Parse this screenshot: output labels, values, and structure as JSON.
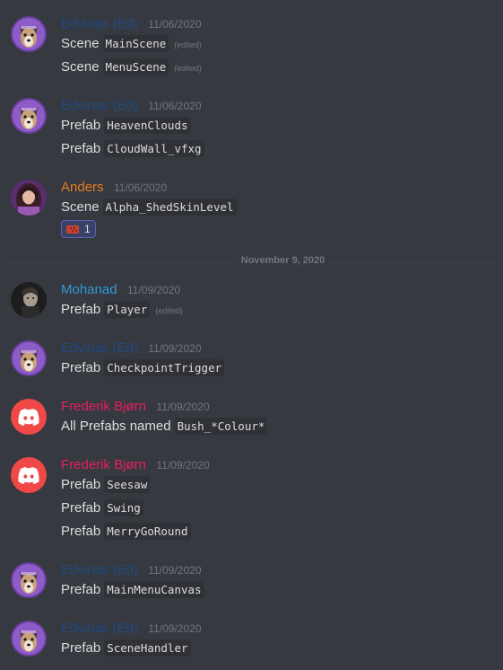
{
  "colors": {
    "background": "#36393f",
    "text": "#dcddde",
    "timestamp": "#72767d",
    "author_edvinas": "#1e4b84",
    "author_anders": "#e67e22",
    "author_mohanad": "#3498db",
    "author_frederik": "#e91e63",
    "discord_brand": "#f04747"
  },
  "divider": {
    "label": "November 9, 2020"
  },
  "messages": [
    {
      "author": "Edvinas (Ed)",
      "time": "11/06/2020",
      "avatar": "dog-avatar-icon",
      "lines": [
        {
          "prefix": "Scene",
          "code": "MainScene",
          "edited": "(edited)"
        },
        {
          "prefix": "Scene",
          "code": "MenuScene",
          "edited": "(edited)"
        }
      ]
    },
    {
      "author": "Edvinas (Ed)",
      "time": "11/06/2020",
      "avatar": "dog-avatar-icon",
      "lines": [
        {
          "prefix": "Prefab",
          "code": "HeavenClouds"
        },
        {
          "prefix": "Prefab",
          "code": "CloudWall_vfxg"
        }
      ]
    },
    {
      "author": "Anders",
      "time": "11/06/2020",
      "avatar": "person-avatar-icon",
      "lines": [
        {
          "prefix": "Scene",
          "code": "Alpha_ShedSkinLevel"
        }
      ],
      "reaction": {
        "icon": "brick-emoji-icon",
        "count": "1"
      }
    },
    {
      "author": "Mohanad",
      "time": "11/09/2020",
      "avatar": "portrait-avatar-icon",
      "lines": [
        {
          "prefix": "Prefab",
          "code": "Player",
          "edited": "(edited)"
        }
      ]
    },
    {
      "author": "Edvinas (Ed)",
      "time": "11/09/2020",
      "avatar": "dog-avatar-icon",
      "lines": [
        {
          "prefix": "Prefab",
          "code": "CheckpointTrigger"
        }
      ]
    },
    {
      "author": "Frederik Bjørn",
      "time": "11/09/2020",
      "avatar": "discord-logo-icon",
      "lines": [
        {
          "prefix": "All Prefabs named",
          "code": "Bush_*Colour*"
        }
      ]
    },
    {
      "author": "Frederik Bjørn",
      "time": "11/09/2020",
      "avatar": "discord-logo-icon",
      "lines": [
        {
          "prefix": "Prefab",
          "code": "Seesaw"
        },
        {
          "prefix": "Prefab",
          "code": "Swing"
        },
        {
          "prefix": "Prefab",
          "code": "MerryGoRound"
        }
      ]
    },
    {
      "author": "Edvinas (Ed)",
      "time": "11/09/2020",
      "avatar": "dog-avatar-icon",
      "lines": [
        {
          "prefix": "Prefab",
          "code": "MainMenuCanvas"
        }
      ]
    },
    {
      "author": "Edvinas (Ed)",
      "time": "11/09/2020",
      "avatar": "dog-avatar-icon",
      "lines": [
        {
          "prefix": "Prefab",
          "code": "SceneHandler"
        }
      ]
    }
  ]
}
